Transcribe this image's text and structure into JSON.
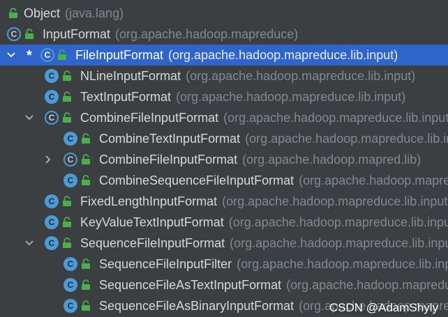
{
  "hierarchy": {
    "rows": [
      {
        "name": "Object",
        "package": "(java.lang)",
        "expand": "none",
        "marker": "",
        "icon": "lock-only"
      },
      {
        "name": "InputFormat",
        "package": "(org.apache.hadoop.mapreduce)",
        "expand": "none",
        "marker": "",
        "icon": "abstract-class"
      },
      {
        "name": "FileInputFormat",
        "package": "(org.apache.hadoop.mapreduce.lib.input)",
        "expand": "expanded",
        "marker": "*",
        "icon": "abstract-class",
        "selected": true
      },
      {
        "name": "NLineInputFormat",
        "package": "(org.apache.hadoop.mapreduce.lib.input)",
        "expand": "none",
        "marker": "",
        "icon": "class"
      },
      {
        "name": "TextInputFormat",
        "package": "(org.apache.hadoop.mapreduce.lib.input)",
        "expand": "none",
        "marker": "",
        "icon": "class"
      },
      {
        "name": "CombineFileInputFormat",
        "package": "(org.apache.hadoop.mapreduce.lib.input)",
        "expand": "expanded",
        "marker": "",
        "icon": "abstract-class"
      },
      {
        "name": "CombineTextInputFormat",
        "package": "(org.apache.hadoop.mapreduce.lib.input)",
        "expand": "none",
        "marker": "",
        "icon": "class"
      },
      {
        "name": "CombineFileInputFormat",
        "package": "(org.apache.hadoop.mapred.lib)",
        "expand": "collapsed",
        "marker": "",
        "icon": "abstract-class"
      },
      {
        "name": "CombineSequenceFileInputFormat",
        "package": "(org.apache.hadoop.mapreduce.lib.input)",
        "expand": "none",
        "marker": "",
        "icon": "class"
      },
      {
        "name": "FixedLengthInputFormat",
        "package": "(org.apache.hadoop.mapreduce.lib.input)",
        "expand": "none",
        "marker": "",
        "icon": "class"
      },
      {
        "name": "KeyValueTextInputFormat",
        "package": "(org.apache.hadoop.mapreduce.lib.input)",
        "expand": "none",
        "marker": "",
        "icon": "class"
      },
      {
        "name": "SequenceFileInputFormat",
        "package": "(org.apache.hadoop.mapreduce.lib.input)",
        "expand": "expanded",
        "marker": "",
        "icon": "class"
      },
      {
        "name": "SequenceFileInputFilter",
        "package": "(org.apache.hadoop.mapreduce.lib.input)",
        "expand": "none",
        "marker": "",
        "icon": "class"
      },
      {
        "name": "SequenceFileAsTextInputFormat",
        "package": "(org.apache.hadoop.mapreduce.lib.input)",
        "expand": "none",
        "marker": "",
        "icon": "class"
      },
      {
        "name": "SequenceFileAsBinaryInputFormat",
        "package": "(org.apache.hadoop.mapreduce.lib.input)",
        "expand": "none",
        "marker": "",
        "icon": "class"
      }
    ]
  },
  "watermark": "CSDN @AdamShyly",
  "colors": {
    "background": "#3c3f41",
    "selection": "#2f65ca",
    "class_icon": "#4a9bd6",
    "lock_icon": "#4cae4c",
    "text": "#d8d8d8",
    "package_text": "#7f8a92"
  }
}
